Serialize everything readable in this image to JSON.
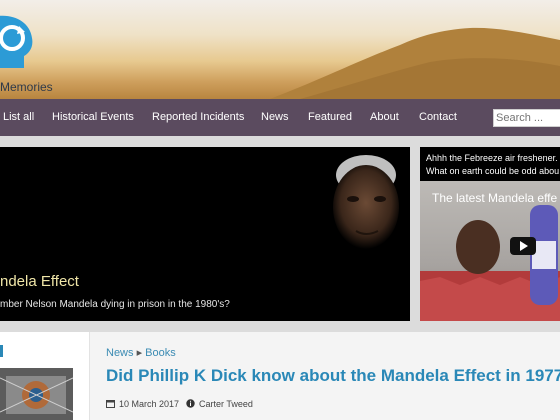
{
  "site": {
    "title": "Memories"
  },
  "nav": {
    "items": [
      "List all",
      "Historical Events",
      "Reported Incidents",
      "News",
      "Featured",
      "About",
      "Contact"
    ],
    "search_placeholder": "Search ..."
  },
  "hero": {
    "title": "ndela Effect",
    "subtitle": "mber Nelson Mandela dying in prison in the 1980's?"
  },
  "sidebar": {
    "line1": "Ahhh the Febreeze air freshener.",
    "line2": "What on earth could be odd abou",
    "video_title": "The latest Mandela effe"
  },
  "post": {
    "breadcrumb": [
      "News",
      "Books"
    ],
    "title": "Did Phillip K Dick know about the Mandela Effect in 1977?",
    "date": "10 March 2017",
    "author": "Carter Tweed"
  },
  "colors": {
    "nav_bg": "#5b4b5f",
    "link": "#2a88b7",
    "hero_title": "#f0e6a8"
  },
  "icons": {
    "logo": "head-refresh-icon",
    "date": "calendar-icon",
    "author": "person-icon",
    "play": "play-icon"
  }
}
